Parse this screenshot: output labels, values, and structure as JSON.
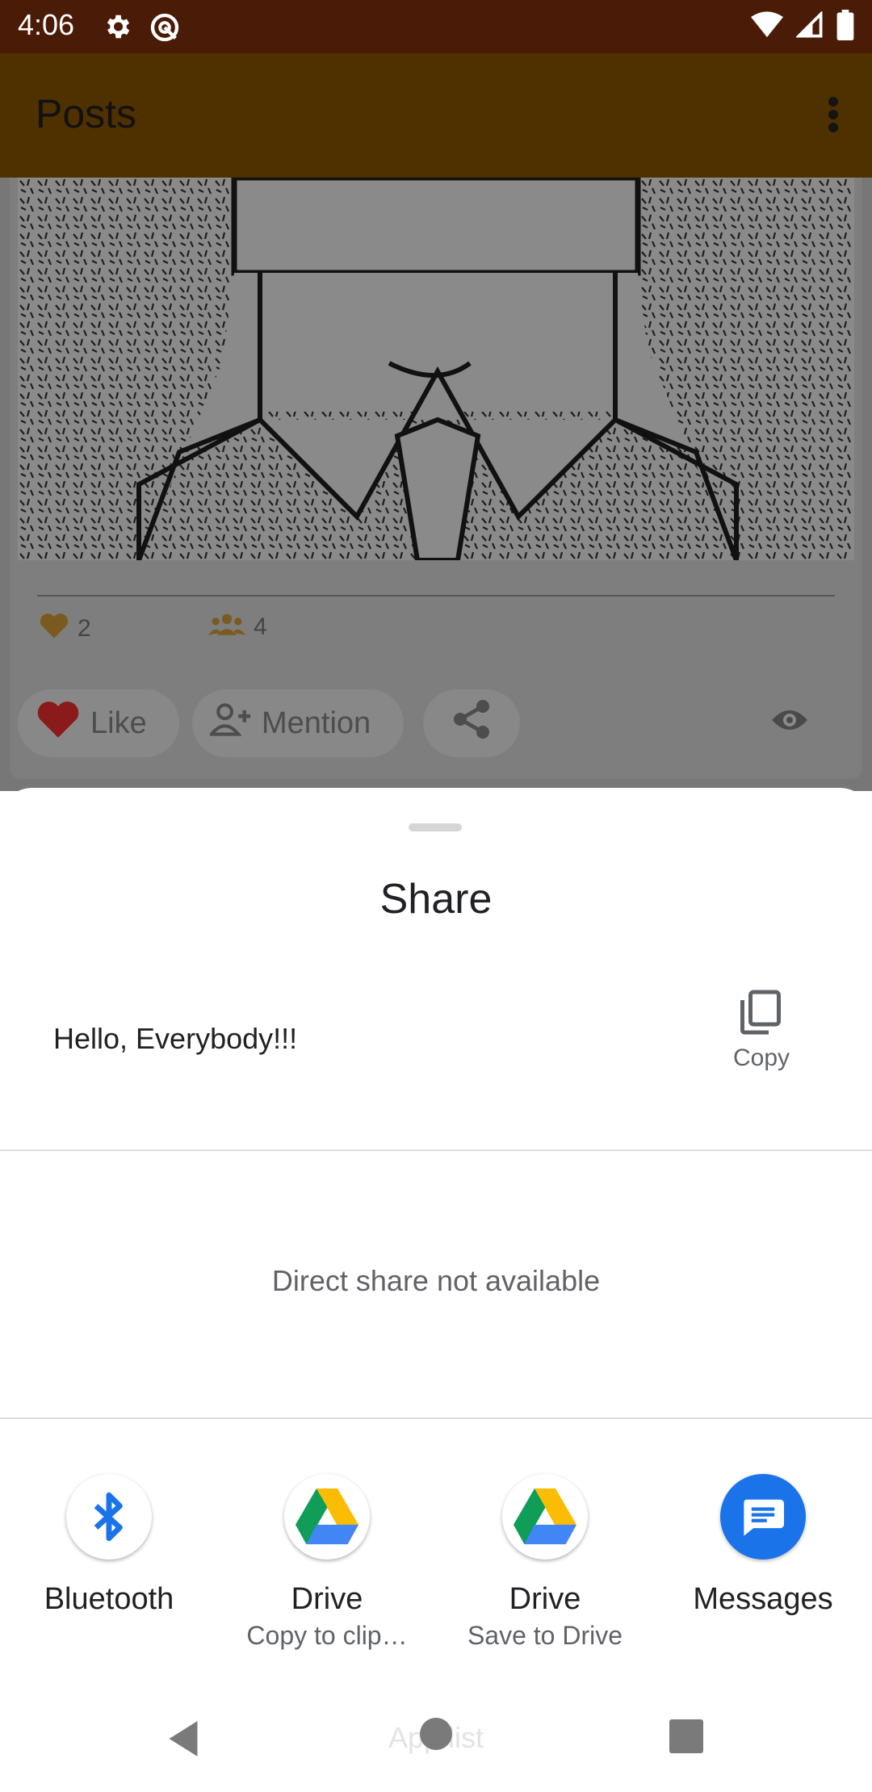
{
  "status_bar": {
    "time": "4:06"
  },
  "app_bar": {
    "title": "Posts"
  },
  "post": {
    "likes_count": "2",
    "mentions_count": "4",
    "actions": {
      "like_label": "Like",
      "mention_label": "Mention"
    }
  },
  "share_sheet": {
    "title": "Share",
    "shared_text": "Hello, Everybody!!!",
    "copy_label": "Copy",
    "direct_share_message": "Direct share not available",
    "targets": [
      {
        "label": "Bluetooth",
        "sublabel": "",
        "icon": "bluetooth-icon"
      },
      {
        "label": "Drive",
        "sublabel": "Copy to clip…",
        "icon": "google-drive-icon"
      },
      {
        "label": "Drive",
        "sublabel": "Save to Drive",
        "icon": "google-drive-icon"
      },
      {
        "label": "Messages",
        "sublabel": "",
        "icon": "messages-icon"
      }
    ]
  },
  "nav_bar": {
    "hint": "App list"
  },
  "colors": {
    "status_bar": "#4a1b06",
    "app_bar_dimmed": "#4f3100",
    "scrim_gray": "#7e7e7e",
    "like_red": "#8b1a1a",
    "messages_blue": "#1a73e8",
    "bluetooth_blue": "#1a73e8"
  }
}
